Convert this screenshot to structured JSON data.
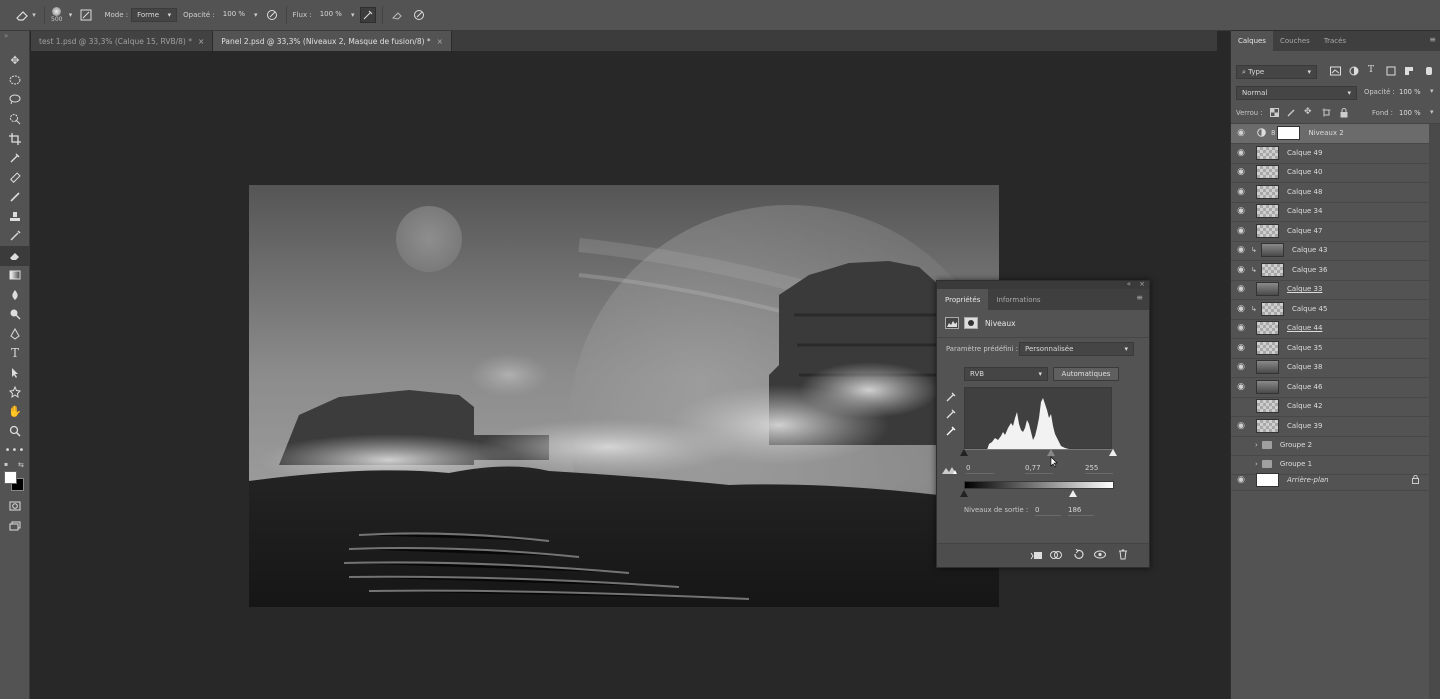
{
  "options_bar": {
    "brush_size": "500",
    "mode_label": "Mode :",
    "mode_value": "Forme",
    "opacity_label": "Opacité :",
    "opacity_value": "100 %",
    "flow_label": "Flux :",
    "flow_value": "100 %"
  },
  "tabs": [
    {
      "label": "test 1.psd @ 33,3% (Calque 15, RVB/8) *",
      "close": "×"
    },
    {
      "label": "Panel 2.psd @ 33,3% (Niveaux 2, Masque de fusion/8) *",
      "close": "×"
    }
  ],
  "layers_panel": {
    "tabs": [
      "Calques",
      "Couches",
      "Tracés"
    ],
    "filter_kind": "Type",
    "blend_mode": "Normal",
    "opacity_label": "Opacité :",
    "opacity_value": "100 %",
    "lock_label": "Verrou :",
    "fill_label": "Fond :",
    "fill_value": "100 %",
    "layers": [
      {
        "name": "Niveaux 2"
      },
      {
        "name": "Calque 49"
      },
      {
        "name": "Calque 40"
      },
      {
        "name": "Calque 48"
      },
      {
        "name": "Calque 34"
      },
      {
        "name": "Calque 47"
      },
      {
        "name": "Calque 43"
      },
      {
        "name": "Calque 36"
      },
      {
        "name": "Calque 33"
      },
      {
        "name": "Calque 45"
      },
      {
        "name": "Calque 44"
      },
      {
        "name": "Calque 35"
      },
      {
        "name": "Calque 38"
      },
      {
        "name": "Calque 46"
      },
      {
        "name": "Calque 42"
      },
      {
        "name": "Calque 39"
      },
      {
        "name": "Groupe 2"
      },
      {
        "name": "Groupe 1"
      },
      {
        "name": "Arrière-plan"
      }
    ]
  },
  "properties": {
    "tabs": [
      "Propriétés",
      "Informations"
    ],
    "adjustment_title": "Niveaux",
    "preset_label": "Paramètre prédéfini :",
    "preset_value": "Personnalisée",
    "channel_value": "RVB",
    "auto_button": "Automatiques",
    "input_black": "0",
    "input_gamma": "0,77",
    "input_white": "255",
    "output_label": "Niveaux de sortie :",
    "output_black": "0",
    "output_white": "186"
  },
  "colors": {
    "ui_bg": "#535353",
    "canvas_bg": "#282828",
    "selected_layer": "#6b6b6b"
  }
}
